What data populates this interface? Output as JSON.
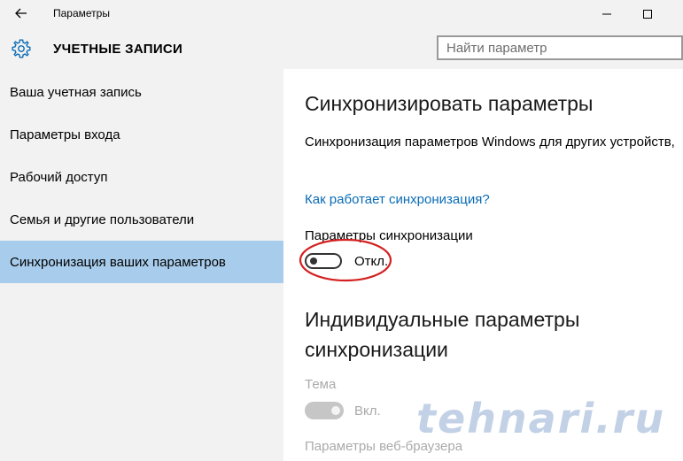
{
  "window": {
    "title": "Параметры",
    "back_icon": "arrow-left-icon",
    "minimize_icon": "minimize-icon",
    "maximize_icon": "maximize-icon"
  },
  "header": {
    "icon": "gear-icon",
    "title": "УЧЕТНЫЕ ЗАПИСИ",
    "search_placeholder": "Найти параметр",
    "search_value": ""
  },
  "sidebar": {
    "items": [
      {
        "label": "Ваша учетная запись",
        "active": false
      },
      {
        "label": "Параметры входа",
        "active": false
      },
      {
        "label": "Рабочий доступ",
        "active": false
      },
      {
        "label": "Семья и другие пользователи",
        "active": false
      },
      {
        "label": "Синхронизация ваших параметров",
        "active": true
      }
    ]
  },
  "main": {
    "title": "Синхронизировать параметры",
    "description": "Синхронизация параметров Windows для других устройств,",
    "help_link": "Как работает синхронизация?",
    "sync_label": "Параметры синхронизации",
    "sync_state": "Откл.",
    "sync_on": false,
    "individual_title_line1": "Индивидуальные параметры",
    "individual_title_line2": "синхронизации",
    "theme_label": "Тема",
    "theme_state": "Вкл.",
    "theme_on": true,
    "browser_label": "Параметры веб-браузера"
  },
  "watermark": "tehnari.ru",
  "colors": {
    "accent_selection": "#a8cdec",
    "link": "#0a6cb6",
    "highlight": "#d42020"
  }
}
